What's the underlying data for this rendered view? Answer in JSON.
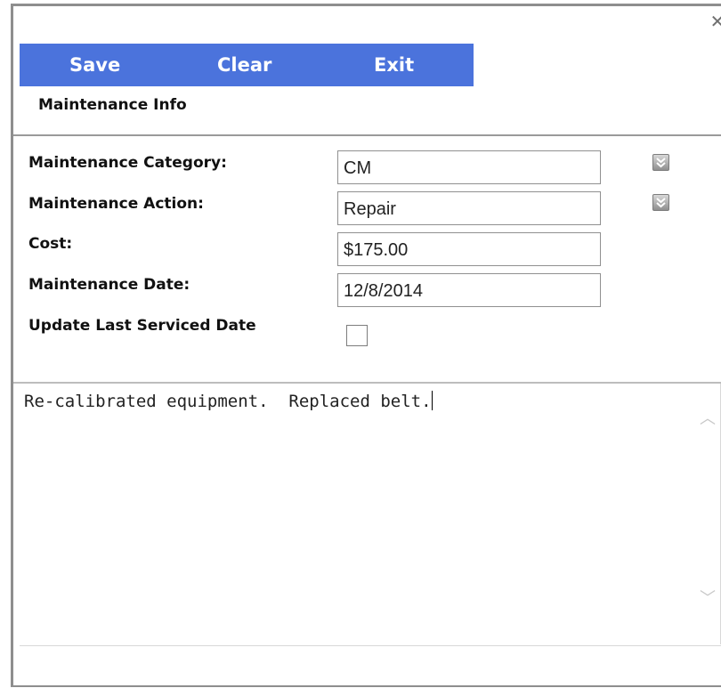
{
  "toolbar": {
    "save_label": "Save",
    "clear_label": "Clear",
    "exit_label": "Exit",
    "background": "#4b73dc"
  },
  "section": {
    "title": "Maintenance Info"
  },
  "form": {
    "category_label": "Maintenance Category:",
    "category_value": "CM",
    "action_label": "Maintenance Action:",
    "action_value": "Repair",
    "cost_label": "Cost:",
    "cost_value": "$175.00",
    "date_label": "Maintenance Date:",
    "date_value": "12/8/2014",
    "update_label": "Update Last Serviced Date",
    "update_checked": false
  },
  "notes": {
    "text": "Re-calibrated equipment.  Replaced belt."
  },
  "icons": {
    "close": "close-icon",
    "dropdown": "chevron-double-down-icon",
    "scroll_up": "chevron-up-icon",
    "scroll_down": "chevron-down-icon"
  }
}
